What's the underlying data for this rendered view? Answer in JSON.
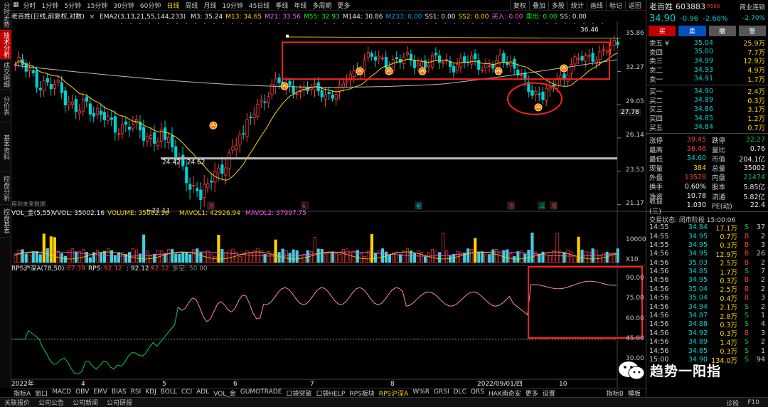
{
  "left_tabs": [
    "分时走势",
    "技术分析",
    "成交明细",
    "分价表",
    "基本资料",
    "控盘分析",
    "控盘基本"
  ],
  "period_tabs": [
    "分时",
    "1分钟",
    "5分钟",
    "15分钟",
    "30分钟",
    "60分钟",
    "日线",
    "周线",
    "月线",
    "10分钟",
    "45日线",
    "季线",
    "年线",
    "多周期",
    "更多"
  ],
  "period_active": "日线",
  "period_right": [
    "复权",
    "叠加",
    "多股",
    "统计",
    "画线",
    "标记",
    "返回"
  ],
  "ema_line": {
    "title": "老百姓(日线,前复权,对数)",
    "name": "EMA2(3,13,21,55,144,233)",
    "items": [
      {
        "k": "M3: 35.24",
        "c": "#e8e8e8"
      },
      {
        "k": "M13: 34.65",
        "c": "#ffd400"
      },
      {
        "k": "M21: 33.56",
        "c": "#ff55ff"
      },
      {
        "k": "M55: 32.93",
        "c": "#00ff00"
      },
      {
        "k": "M144: 30.86",
        "c": "#e8e8e8"
      },
      {
        "k": "M233: 0.00",
        "c": "#00a0ff"
      },
      {
        "k": "SS1: 0.00",
        "c": "#e8e8e8"
      },
      {
        "k": "SS2: 0.00",
        "c": "#ffd400"
      },
      {
        "k": "买入: 0.00",
        "c": "#ff55ff"
      },
      {
        "k": "卖出: 0.00",
        "c": "#00ff00"
      },
      {
        "k": "SS: 0.00",
        "c": "#e8e8e8"
      }
    ]
  },
  "price_axis": [
    "35.86",
    "32.27",
    "29.05",
    "27.78",
    "26.14",
    "23.53",
    "21.17"
  ],
  "price_annotations": {
    "high": "36.46",
    "low": "←21.11",
    "range": "24.42 - 24.62",
    "future": "用到未来数据"
  },
  "event_markers": [
    {
      "t": "涨",
      "c": "#ff3b3b"
    },
    {
      "t": "6",
      "c": "#ff3b3b"
    },
    {
      "t": "能",
      "c": "#00d0d0"
    },
    {
      "t": "涨",
      "c": "#ff3b3b"
    },
    {
      "t": "减",
      "c": "#00c853"
    },
    {
      "t": "增",
      "c": "#ff3b3b"
    }
  ],
  "vol_line": {
    "name": "VOL_金(5,55)",
    "vvol": "VVOL: 35002.16",
    "volume": "VOLUME: 35002.16",
    "mavol1": "MAVOL1: 42926.94",
    "mavol2": "MAVOL2: 37997.75"
  },
  "vol_axis": [
    "10000",
    "X10"
  ],
  "rps_line": {
    "name": "RPS沪深A(78,50)",
    "a": "87.39",
    "b": "92.12",
    "c": "92.12",
    "d": "92.12",
    "e": "多空: 50.00",
    "label_rps": "RPS:"
  },
  "rps_axis": [
    "90.00",
    "75.00",
    "60.00",
    "45.00",
    "30.00"
  ],
  "time_axis": [
    "2022年",
    "4",
    "5",
    "6",
    "7",
    "8",
    "2022/09/01/四",
    "10"
  ],
  "indicator_tabs": [
    "指标A",
    "窗口",
    "MACD",
    "OBV",
    "EMV",
    "BIAS",
    "RSI",
    "KDJ",
    "BOLL",
    "CCI",
    "ADL",
    "VOL_金",
    "GUMOTRADE",
    "口袋突破",
    "口袋HELP",
    "RPS板块",
    "RPS沪深A",
    "W%R",
    "GRSI",
    "DLC",
    "QRS",
    "HAK南奇安",
    "更多",
    "设置"
  ],
  "indicator_active": "RPS沪深A",
  "indicator_right": [
    "指标B",
    "模板"
  ],
  "status_tabs": [
    "关联报价",
    "公司公告",
    "公司新闻",
    "公司研报"
  ],
  "status_right": [
    "诊股",
    "F10"
  ],
  "quote": {
    "name": "老百姓",
    "code": "603883",
    "r_tag": "R500",
    "tag": "商业连锁",
    "price": "34.90",
    "chg": "-0.96",
    "pct": "-2.68%",
    "pct_right": "-2.70%",
    "buttons": [
      {
        "t": "买",
        "c": "#c00000"
      },
      {
        "t": "卖",
        "c": "#0050c0"
      },
      {
        "t": "撤",
        "c": "#555"
      },
      {
        "t": "警",
        "c": "#555"
      }
    ],
    "asks": [
      {
        "l": "卖五 ¥",
        "p": "35.04",
        "v": "25.9万"
      },
      {
        "l": "卖四",
        "p": "35.00",
        "v": "7.7万"
      },
      {
        "l": "卖三",
        "p": "34.99",
        "v": "12.9万"
      },
      {
        "l": "卖二",
        "p": "34.93",
        "v": "4.9万"
      },
      {
        "l": "卖一",
        "p": "34.91",
        "v": "1.7万"
      }
    ],
    "bids": [
      {
        "l": "买一",
        "p": "34.90",
        "v": "2.4万"
      },
      {
        "l": "买二",
        "p": "34.89",
        "v": "0.3万"
      },
      {
        "l": "买三",
        "p": "34.86",
        "v": "3.1万"
      },
      {
        "l": "买四",
        "p": "34.85",
        "v": "1.2万"
      },
      {
        "l": "买五",
        "p": "34.84",
        "v": "0.7万"
      }
    ],
    "stats": [
      {
        "l1": "涨停",
        "v1": "39.45",
        "c1": "#ff3b3b",
        "l2": "跌停",
        "v2": "32.27",
        "c2": "#00c853"
      },
      {
        "l1": "最高",
        "v1": "36.46",
        "c1": "#ff3b3b",
        "l2": "量比",
        "v2": "0.76",
        "c2": "#e8e8e8"
      },
      {
        "l1": "最低",
        "v1": "34.60",
        "c1": "#00d0d0",
        "l2": "市值",
        "v2": "204.1亿",
        "c2": "#e8e8e8"
      },
      {
        "l1": "现量",
        "v1": "384",
        "c1": "#ffd400",
        "l2": "总量",
        "v2": "35002",
        "c2": "#e8e8e8"
      },
      {
        "l1": "外盘",
        "v1": "13528",
        "c1": "#ff3b3b",
        "l2": "内盘",
        "v2": "21474",
        "c2": "#00c853"
      },
      {
        "l1": "换手",
        "v1": "0.60%",
        "c1": "#e8e8e8",
        "l2": "股本",
        "v2": "5.85亿",
        "c2": "#e8e8e8"
      },
      {
        "l1": "净资",
        "v1": "10.78",
        "c1": "#e8e8e8",
        "l2": "流通",
        "v2": "5.82亿",
        "c2": "#e8e8e8"
      },
      {
        "l1": "收益(三)",
        "v1": "1.030",
        "c1": "#e8e8e8",
        "l2": "PE(动)",
        "v2": "22.4",
        "c2": "#e8e8e8"
      }
    ],
    "trade_state": "交易状态: 闭市阶段 15:00:06",
    "ticks": [
      {
        "t": "14:55",
        "p": "34.84",
        "pc": "#00d0d0",
        "v": "17.1万",
        "s": "S",
        "n": "37"
      },
      {
        "t": "14:55",
        "p": "34.95",
        "pc": "#00d0d0",
        "v": "0.7万",
        "s": "B",
        "n": "2"
      },
      {
        "t": "14:55",
        "p": "34.95",
        "pc": "#00d0d0",
        "v": "0.3万",
        "s": "B",
        "n": "3"
      },
      {
        "t": "14:56",
        "p": "34.95",
        "pc": "#00d0d0",
        "v": "12.9万",
        "s": "B",
        "n": "26"
      },
      {
        "t": "14:56",
        "p": "35.03",
        "pc": "#00d0d0",
        "v": "2.5万",
        "s": "B",
        "n": "2"
      },
      {
        "t": "14:56",
        "p": "34.85",
        "pc": "#00d0d0",
        "v": "1.7万",
        "s": "S",
        "n": "7"
      },
      {
        "t": "14:56",
        "p": "34.95",
        "pc": "#00d0d0",
        "v": "0.3万",
        "s": "B",
        "n": "2"
      },
      {
        "t": "14:56",
        "p": "35.04",
        "pc": "#00d0d0",
        "v": "2.5万",
        "s": "B",
        "n": "2"
      },
      {
        "t": "14:56",
        "p": "35.04",
        "pc": "#00d0d0",
        "v": "0.4万",
        "s": "B",
        "n": "3"
      },
      {
        "t": "14:56",
        "p": "34.94",
        "pc": "#00d0d0",
        "v": "2.1万",
        "s": "S",
        "n": "2"
      },
      {
        "t": "14:56",
        "p": "34.87",
        "pc": "#00d0d0",
        "v": "2.8万",
        "s": "S",
        "n": "1"
      },
      {
        "t": "14:56",
        "p": "34.88",
        "pc": "#00d0d0",
        "v": "0.3万",
        "s": "S",
        "n": "4"
      },
      {
        "t": "14:56",
        "p": "34.92",
        "pc": "#00d0d0",
        "v": "0.3万",
        "s": "B",
        "n": "3"
      },
      {
        "t": "14:56",
        "p": "34.89",
        "pc": "#00d0d0",
        "v": "1.4万",
        "s": "S",
        "n": "2"
      },
      {
        "t": "14:56",
        "p": "34.85",
        "pc": "#00d0d0",
        "v": "0.3万",
        "s": "S",
        "n": "1"
      },
      {
        "t": "15:00",
        "p": "34.90",
        "pc": "#00d0d0",
        "v": "134.0万",
        "s": "S",
        "n": "94"
      }
    ]
  },
  "watermark": "趋势一阳指",
  "colors": {
    "up": "#ff3b3b",
    "down": "#00d0d0",
    "ma13": "#ffd400",
    "box": "#ff2020"
  }
}
